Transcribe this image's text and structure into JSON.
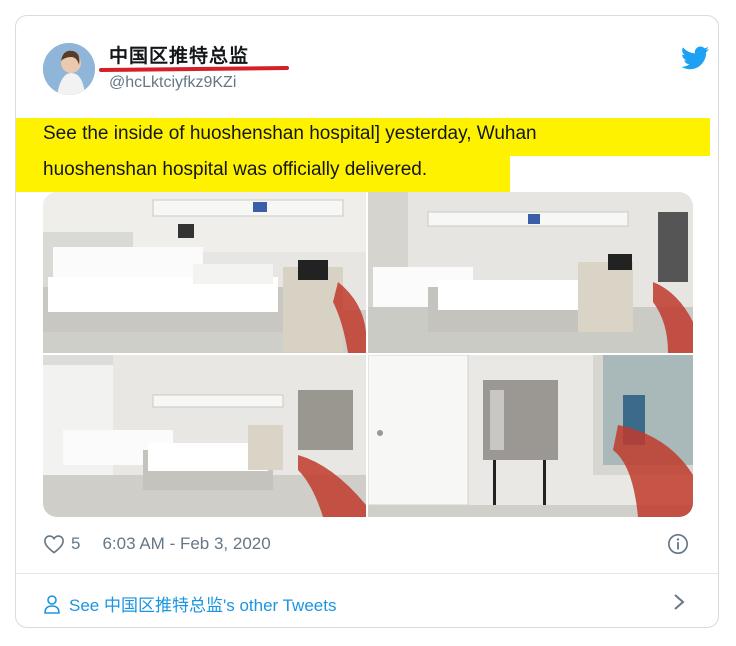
{
  "tweet": {
    "display_name": "中国区推特总监",
    "handle": "@hcLktciyfkz9KZi",
    "text_line1": "See the inside of huoshenshan hospital] yesterday, Wuhan",
    "text_line2": "huoshenshan hospital was officially delivered.",
    "likes": "5",
    "timestamp": "6:03 AM - Feb 3, 2020",
    "other_tweets_label": "See 中国区推特总监's other Tweets"
  },
  "icons": {
    "brand": "twitter-bird-icon",
    "like": "heart-icon",
    "info": "info-icon",
    "profile": "person-icon",
    "more": "chevron-right-icon"
  },
  "colors": {
    "highlight": "#fff200",
    "name_underline": "#d62027",
    "link": "#1b95e0",
    "twitter_blue": "#1da1f2",
    "muted": "#657786"
  },
  "photos": [
    {
      "name": "hospital-photo-ward-left"
    },
    {
      "name": "hospital-photo-ward-right"
    },
    {
      "name": "hospital-photo-ward-bottom-left"
    },
    {
      "name": "hospital-photo-cabinet-door"
    }
  ]
}
